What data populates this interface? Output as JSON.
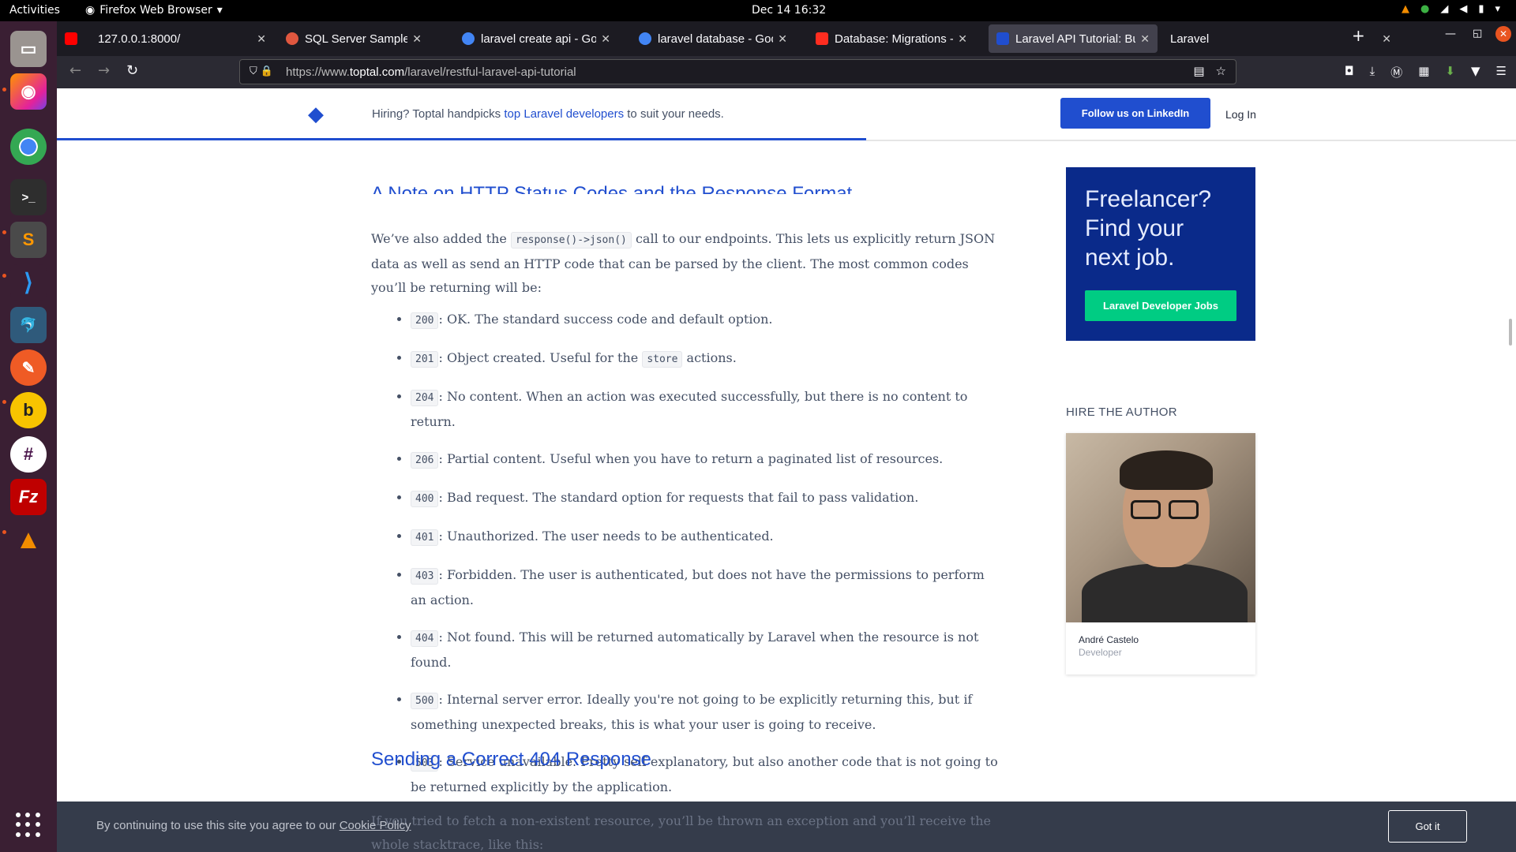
{
  "system": {
    "activities": "Activities",
    "app_name": "Firefox Web Browser",
    "clock": "Dec 14  16:32"
  },
  "tabs": [
    {
      "title": "127.0.0.1:8000/",
      "favicon_color": "#ff0000",
      "icon": "youtube-icon"
    },
    {
      "title": "SQL Server Sample Datab",
      "favicon_color": "#e0573f",
      "icon": "sql-icon"
    },
    {
      "title": "laravel create api - Googl",
      "favicon_color": "#4285f4",
      "icon": "google-icon"
    },
    {
      "title": "laravel database - Google",
      "favicon_color": "#4285f4",
      "icon": "google-icon"
    },
    {
      "title": "Database: Migrations - La",
      "favicon_color": "#ff2d20",
      "icon": "laravel-icon"
    },
    {
      "title": "Laravel API Tutorial: Build",
      "favicon_color": "#204ecf",
      "icon": "toptal-icon"
    },
    {
      "title": "Laravel",
      "favicon_color": "#1c1b22",
      "icon": "blank-icon"
    }
  ],
  "address_bar": {
    "url_prefix": "https://www.",
    "url_domain": "toptal.com",
    "url_path": "/laravel/restful-laravel-api-tutorial"
  },
  "hiring_banner": {
    "prefix": "Hiring? Toptal handpicks ",
    "link": "top Laravel developers",
    "suffix": " to suit your needs.",
    "follow_button": "Follow us on LinkedIn",
    "login": "Log In"
  },
  "article": {
    "cut_heading": "A Note on HTTP Status Codes and the Response Format",
    "intro_before": "We’ve also added the ",
    "intro_code": "response()->json()",
    "intro_after": " call to our endpoints. This lets us explicitly return JSON data as well as send an HTTP code that can be parsed by the client. The most common codes you’ll be returning will be:",
    "codes": [
      {
        "code": "200",
        "text": ": OK. The standard success code and default option."
      },
      {
        "code": "201",
        "text": ": Object created. Useful for the ",
        "code2": "store",
        "text2": " actions."
      },
      {
        "code": "204",
        "text": ": No content. When an action was executed successfully, but there is no content to return."
      },
      {
        "code": "206",
        "text": ": Partial content. Useful when you have to return a paginated list of resources."
      },
      {
        "code": "400",
        "text": ": Bad request. The standard option for requests that fail to pass validation."
      },
      {
        "code": "401",
        "text": ": Unauthorized. The user needs to be authenticated."
      },
      {
        "code": "403",
        "text": ": Forbidden. The user is authenticated, but does not have the permissions to perform an action."
      },
      {
        "code": "404",
        "text": ": Not found. This will be returned automatically by Laravel when the resource is not found."
      },
      {
        "code": "500",
        "text": ": Internal server error. Ideally you're not going to be explicitly returning this, but if something unexpected breaks, this is what your user is going to receive."
      },
      {
        "code": "503",
        "text": ": Service unavailable. Pretty self explanatory, but also another code that is not going to be returned explicitly by the application."
      }
    ],
    "next_heading": "Sending a Correct 404 Response",
    "faded_paragraph": "If you tried to fetch a non-existent resource, you’ll be thrown an exception and you’ll receive the whole stacktrace, like this:"
  },
  "sidebar": {
    "promo_title": "Freelancer? Find your next job.",
    "promo_button": "Laravel Developer Jobs",
    "hire_heading": "HIRE THE AUTHOR",
    "author_name": "André Castelo",
    "author_role": "Developer"
  },
  "cookie_banner": {
    "text": "By continuing to use this site you agree to our ",
    "link": "Cookie Policy",
    "button": "Got it"
  },
  "colors": {
    "accent": "#204ecf",
    "promo_bg": "#0a2a8a",
    "promo_button": "#00cc83"
  }
}
